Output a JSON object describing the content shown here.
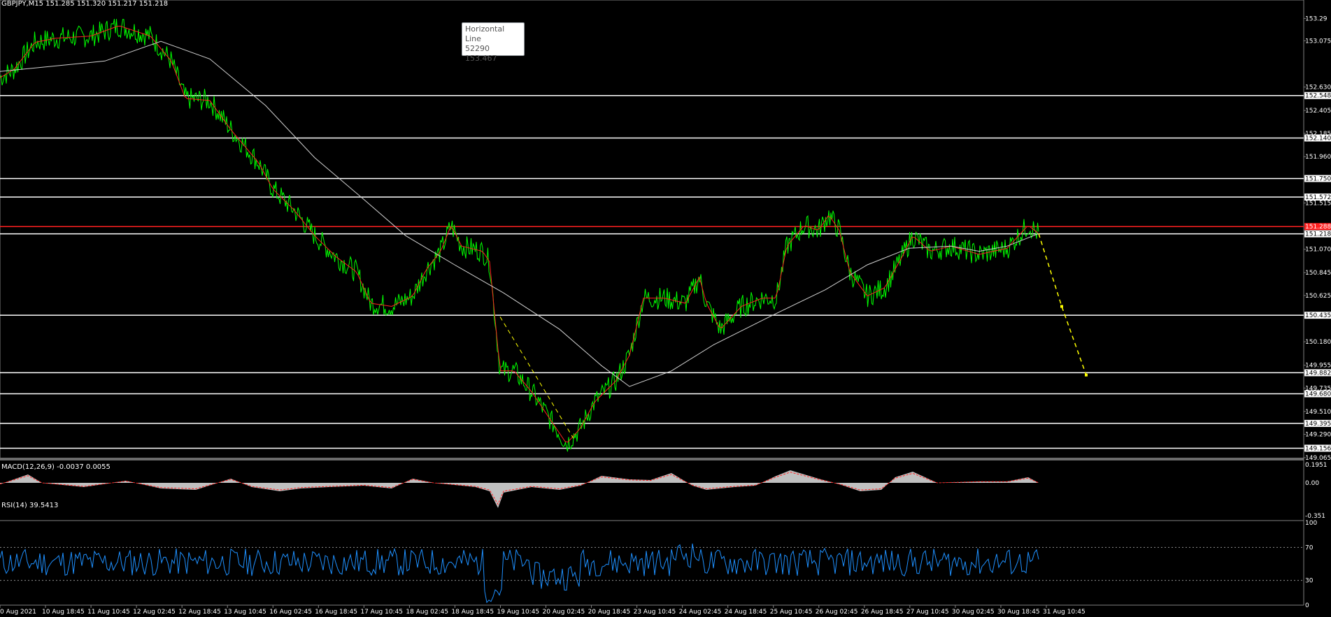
{
  "main_panel": {
    "header": "GBPJPY,M15  151.285 151.320 151.217 151.218",
    "y_ticks": [
      "153.29",
      "153.075",
      "152.630",
      "152.405",
      "152.185",
      "151.960",
      "151.515",
      "151.070",
      "150.845",
      "150.625",
      "150.180",
      "149.955",
      "149.735",
      "149.510",
      "149.290",
      "149.065"
    ],
    "hlines": [
      {
        "label": "152.548",
        "color": "#ffffff"
      },
      {
        "label": "152.140",
        "color": "#ffffff"
      },
      {
        "label": "151.750",
        "color": "#ffffff"
      },
      {
        "label": "151.572",
        "color": "#ffffff"
      },
      {
        "label": "151.288",
        "color": "#ff2020"
      },
      {
        "label": "151.218",
        "color": "#ffffff"
      },
      {
        "label": "150.435",
        "color": "#ffffff"
      },
      {
        "label": "149.882",
        "color": "#ffffff"
      },
      {
        "label": "149.680",
        "color": "#ffffff"
      },
      {
        "label": "149.395",
        "color": "#ffffff"
      },
      {
        "label": "149.156",
        "color": "#ffffff"
      }
    ],
    "tooltip": {
      "title": "Horizontal Line",
      "id": "52290",
      "price": "153.467"
    }
  },
  "macd_panel": {
    "header": "MACD(12,26,9) -0.0037 0.0055",
    "ticks": [
      "0.1951",
      "0.00",
      "-0.351"
    ]
  },
  "rsi_panel": {
    "header": "RSI(14) 39.5413",
    "ticks": [
      "100",
      "70",
      "30",
      "0"
    ]
  },
  "time_axis": {
    "labels": [
      "0 Aug 2021",
      "10 Aug 18:45",
      "11 Aug 10:45",
      "12 Aug 02:45",
      "12 Aug 18:45",
      "13 Aug 10:45",
      "16 Aug 02:45",
      "16 Aug 18:45",
      "17 Aug 10:45",
      "18 Aug 02:45",
      "18 Aug 18:45",
      "19 Aug 10:45",
      "20 Aug 02:45",
      "20 Aug 18:45",
      "23 Aug 10:45",
      "24 Aug 02:45",
      "24 Aug 18:45",
      "25 Aug 10:45",
      "26 Aug 02:45",
      "26 Aug 18:45",
      "27 Aug 10:45",
      "30 Aug 02:45",
      "30 Aug 18:45",
      "31 Aug 10:45"
    ]
  },
  "colors": {
    "price": "#00ff00",
    "fast_ma": "#ff2020",
    "slow_ma": "#d0d0d0",
    "projection": "#ffff00",
    "rsi": "#1e90ff",
    "macd_hist": "#c0c0c0",
    "macd_signal": "#ff2020"
  }
}
